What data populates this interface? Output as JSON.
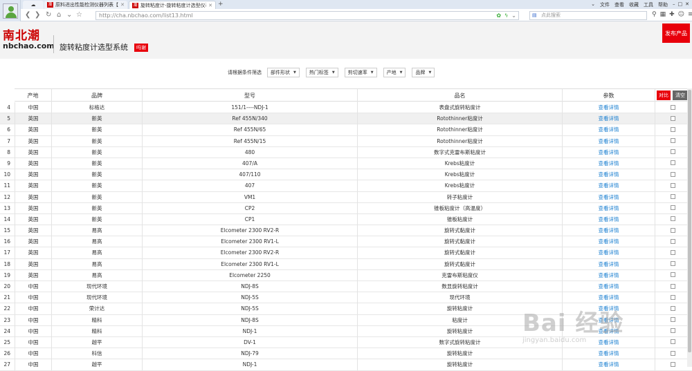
{
  "browser": {
    "tabs": [
      {
        "label": "原料进出性能检测仪器列表【查",
        "favicon": "潮"
      },
      {
        "label": "旋转粘度计-旋转粘度计选型仪表",
        "favicon": "潮"
      }
    ],
    "menus": [
      "文件",
      "查看",
      "收藏",
      "工具",
      "帮助"
    ],
    "url": "http://cha.nbchao.com/list13.html",
    "search_placeholder": "点此搜索"
  },
  "header": {
    "logo_cn": "南北潮",
    "logo_en": "nbchao.com",
    "system_title": "旋转粘度计选型系统",
    "badge": "吗谢",
    "publish_button": "发布产品"
  },
  "filters": {
    "label": "请根据条件筛选",
    "dropdowns": [
      "部件形状",
      "热门标签",
      "剪切速率",
      "产地",
      "品牌"
    ]
  },
  "table": {
    "headers": {
      "origin": "产地",
      "brand": "品牌",
      "model": "型号",
      "name": "品名",
      "param": "参数"
    },
    "compare_button": "对比",
    "clear_button": "清空",
    "detail_link": "查看详情",
    "rows": [
      {
        "no": "4",
        "origin": "中国",
        "brand": "标格达",
        "model": "151/1----NDJ-1",
        "name": "表盘式旋转粘度计"
      },
      {
        "no": "5",
        "origin": "英国",
        "brand": "新英",
        "model": "Ref 455N/340",
        "name": "Rotothinner粘度计"
      },
      {
        "no": "6",
        "origin": "英国",
        "brand": "新英",
        "model": "Ref 455N/65",
        "name": "Rotothinner粘度计"
      },
      {
        "no": "7",
        "origin": "英国",
        "brand": "新英",
        "model": "Ref 455N/15",
        "name": "Rotothinner粘度计"
      },
      {
        "no": "8",
        "origin": "英国",
        "brand": "新英",
        "model": "480",
        "name": "数字式克雷布斯粘度计"
      },
      {
        "no": "9",
        "origin": "英国",
        "brand": "新英",
        "model": "407/A",
        "name": "Krebs粘度计"
      },
      {
        "no": "10",
        "origin": "英国",
        "brand": "新英",
        "model": "407/110",
        "name": "Krebs粘度计"
      },
      {
        "no": "11",
        "origin": "英国",
        "brand": "新英",
        "model": "407",
        "name": "Krebs粘度计"
      },
      {
        "no": "12",
        "origin": "英国",
        "brand": "新英",
        "model": "VM1",
        "name": "转子粘度计"
      },
      {
        "no": "13",
        "origin": "英国",
        "brand": "新英",
        "model": "CP2",
        "name": "锥板粘度计（高温度）"
      },
      {
        "no": "14",
        "origin": "英国",
        "brand": "新英",
        "model": "CP1",
        "name": "锥板粘度计"
      },
      {
        "no": "15",
        "origin": "英国",
        "brand": "易高",
        "model": "Elcometer 2300 RV2-R",
        "name": "旋转式黏度计"
      },
      {
        "no": "16",
        "origin": "英国",
        "brand": "易高",
        "model": "Elcometer 2300 RV1-L",
        "name": "旋转式黏度计"
      },
      {
        "no": "17",
        "origin": "英国",
        "brand": "易高",
        "model": "Elcometer 2300 RV2-R",
        "name": "旋转式黏度计"
      },
      {
        "no": "18",
        "origin": "英国",
        "brand": "易高",
        "model": "Elcometer 2300 RV1-L",
        "name": "旋转式黏度计"
      },
      {
        "no": "19",
        "origin": "英国",
        "brand": "易高",
        "model": "Elcometer 2250",
        "name": "克雷布斯粘度仪"
      },
      {
        "no": "20",
        "origin": "中国",
        "brand": "现代环境",
        "model": "NDJ-8S",
        "name": "数显旋转粘度计"
      },
      {
        "no": "21",
        "origin": "中国",
        "brand": "现代环境",
        "model": "NDJ-5S",
        "name": "现代环境"
      },
      {
        "no": "22",
        "origin": "中国",
        "brand": "荣计达",
        "model": "NDJ-5S",
        "name": "旋转粘度计"
      },
      {
        "no": "23",
        "origin": "中国",
        "brand": "精科",
        "model": "NDJ-8S",
        "name": "粘度计"
      },
      {
        "no": "24",
        "origin": "中国",
        "brand": "精科",
        "model": "NDJ-1",
        "name": "旋转粘度计"
      },
      {
        "no": "25",
        "origin": "中国",
        "brand": "越平",
        "model": "DV-1",
        "name": "数字式旋转粘度计"
      },
      {
        "no": "26",
        "origin": "中国",
        "brand": "科信",
        "model": "NDJ-79",
        "name": "旋转粘度计"
      },
      {
        "no": "27",
        "origin": "中国",
        "brand": "越平",
        "model": "NDJ-1",
        "name": "旋转粘度计"
      }
    ]
  },
  "watermark": {
    "big": "Bai 经验",
    "small": "jingyan.baidu.com"
  }
}
